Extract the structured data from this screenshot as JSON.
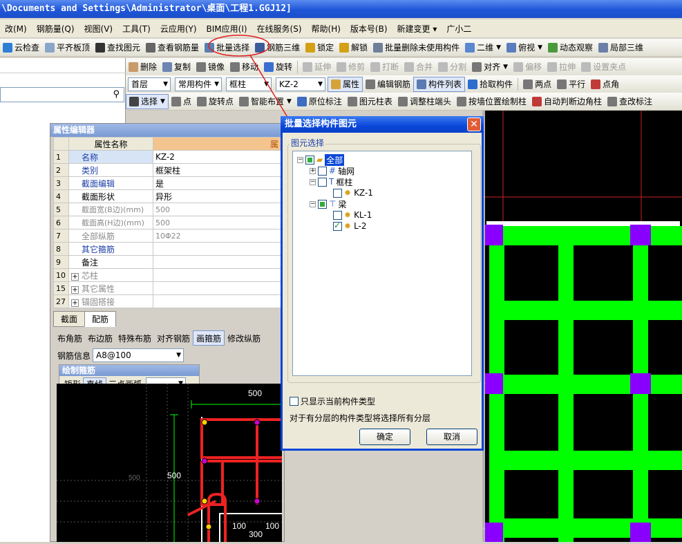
{
  "window": {
    "title": "\\Documents and Settings\\Administrator\\桌面\\工程1.GGJ12]"
  },
  "menu": [
    "改(M)",
    "钢筋量(Q)",
    "视图(V)",
    "工具(T)",
    "云应用(Y)",
    "BIM应用(I)",
    "在线服务(S)",
    "帮助(H)",
    "版本号(B)",
    "新建变更 ▾",
    "广小二"
  ],
  "toolbar1": [
    "云检查",
    "平齐板顶",
    "查找图元",
    "查看钢筋量",
    "批量选择",
    "钢筋三维",
    "锁定",
    "解锁",
    "批量删除未使用构件",
    "二维",
    "俯视",
    "动态观察",
    "局部三维"
  ],
  "toolbar2": {
    "pin": "ㅁ ×",
    "items": [
      "删除",
      "复制",
      "镜像",
      "移动",
      "旋转",
      "延伸",
      "修剪",
      "打断",
      "合并",
      "分割",
      "对齐",
      "偏移",
      "拉伸",
      "设置夹点"
    ]
  },
  "toolbar3": {
    "floor": "首层",
    "comp_type": "常用构件",
    "comp": "框柱",
    "name": "KZ-2",
    "items": [
      "属性",
      "编辑钢筋",
      "构件列表",
      "拾取构件",
      "两点",
      "平行",
      "点角"
    ]
  },
  "toolbar4": [
    "选择",
    "点",
    "旋转点",
    "智能布置",
    "原位标注",
    "图元柱表",
    "调整柱端头",
    "按墙位置绘制柱",
    "自动判断边角柱",
    "查改标注"
  ],
  "property_editor": {
    "title": "属性编辑器",
    "col_header": "属性名称",
    "col_header_value": "属",
    "rows": [
      {
        "no": "1",
        "name": "名称",
        "value": "KZ-2"
      },
      {
        "no": "2",
        "name": "类别",
        "value": "框架柱"
      },
      {
        "no": "3",
        "name": "截面编辑",
        "value": "是"
      },
      {
        "no": "4",
        "name": "截面形状",
        "value": "异形"
      },
      {
        "no": "5",
        "name": "截面宽(B边)(mm)",
        "value": "500"
      },
      {
        "no": "6",
        "name": "截面高(H边)(mm)",
        "value": "500"
      },
      {
        "no": "7",
        "name": "全部纵筋",
        "value": "10Φ22"
      },
      {
        "no": "8",
        "name": "其它箍筋",
        "value": ""
      },
      {
        "no": "9",
        "name": "备注",
        "value": ""
      },
      {
        "no": "10",
        "name": "芯柱",
        "value": ""
      },
      {
        "no": "15",
        "name": "其它属性",
        "value": ""
      },
      {
        "no": "27",
        "name": "锚固搭接",
        "value": ""
      }
    ],
    "tabs": [
      "截面",
      "配筋"
    ],
    "rebar_tools": [
      "布角筋",
      "布边筋",
      "特殊布筋",
      "对齐钢筋",
      "画箍筋",
      "修改纵筋"
    ],
    "rebar_info_label": "钢筋信息",
    "rebar_info_value": "A8@100",
    "draw_stirrup_title": "绘制箍筋",
    "draw_stirrup_tools": [
      "矩形",
      "直线",
      "三点画弧"
    ]
  },
  "section_dims": [
    "500",
    "500",
    "500",
    "100",
    "100",
    "300",
    "500",
    "500"
  ],
  "dialog": {
    "title": "批量选择构件图元",
    "group_label": "图元选择",
    "tree": [
      "全部",
      "轴网",
      "框柱",
      "KZ-1",
      "梁",
      "KL-1",
      "L-2"
    ],
    "only_current": "只显示当前构件类型",
    "note": "对于有分层的构件类型将选择所有分层",
    "ok": "确定",
    "cancel": "取消"
  },
  "colors": {
    "accent": "#0a46d8",
    "beam": "#00ff00",
    "column": "#8a00ff",
    "annotation": "#e02020"
  }
}
